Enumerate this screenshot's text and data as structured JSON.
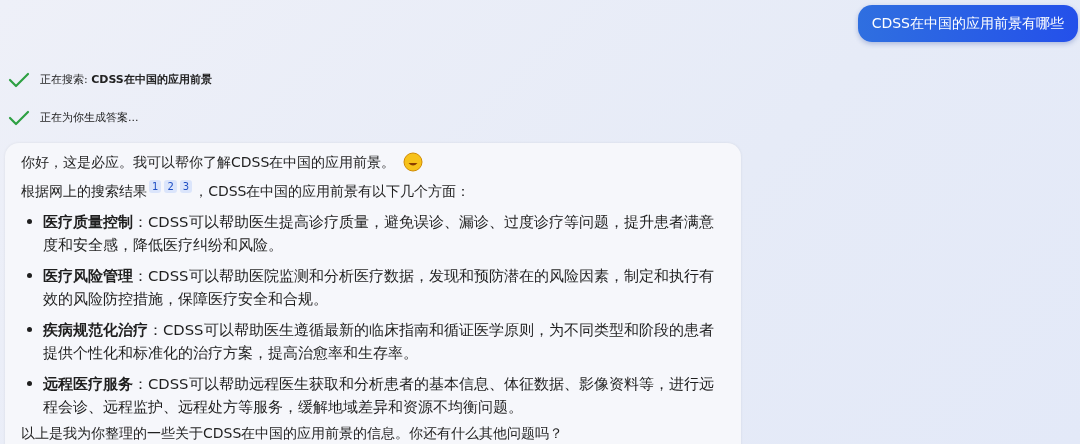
{
  "user_message": "CDSS在中国的应用前景有哪些",
  "steps": [
    {
      "text": "正在搜索: **CDSS在中国的应用前景**",
      "done": true
    },
    {
      "text": "正在为你生成答案...",
      "done": true
    }
  ],
  "answer": {
    "greeting": "你好，这是必应。我可以帮你了解CDSS在中国的应用前景。",
    "intro_before": "根据网上的搜索结果",
    "citations": [
      "1",
      "2",
      "3"
    ],
    "intro_after": "，CDSS在中国的应用前景有以下几个方面：",
    "items": [
      {
        "text": "**医疗质量控制**：CDSS可以帮助医生提高诊疗质量，避免误诊、漏诊、过度诊疗等问题，提升患者满意度和安全感，降低医疗纠纷和风险。"
      },
      {
        "text": "**医疗风险管理**：CDSS可以帮助医院监测和分析医疗数据，发现和预防潜在的风险因素，制定和执行有效的风险防控措施，保障医疗安全和合规。"
      },
      {
        "text": "**疾病规范化治疗**：CDSS可以帮助医生遵循最新的临床指南和循证医学原则，为不同类型和阶段的患者提供个性化和标准化的治疗方案，提高治愈率和生存率。"
      },
      {
        "text": "**远程医疗服务**：CDSS可以帮助远程医生获取和分析患者的基本信息、体征数据、影像资料等，进行远程会诊、远程监护、远程处方等服务，缓解地域差异和资源不均衡问题。"
      }
    ],
    "closing": "以上是我为你整理的一些关于CDSS在中国的应用前景的信息。你还有什么其他问题吗？"
  }
}
